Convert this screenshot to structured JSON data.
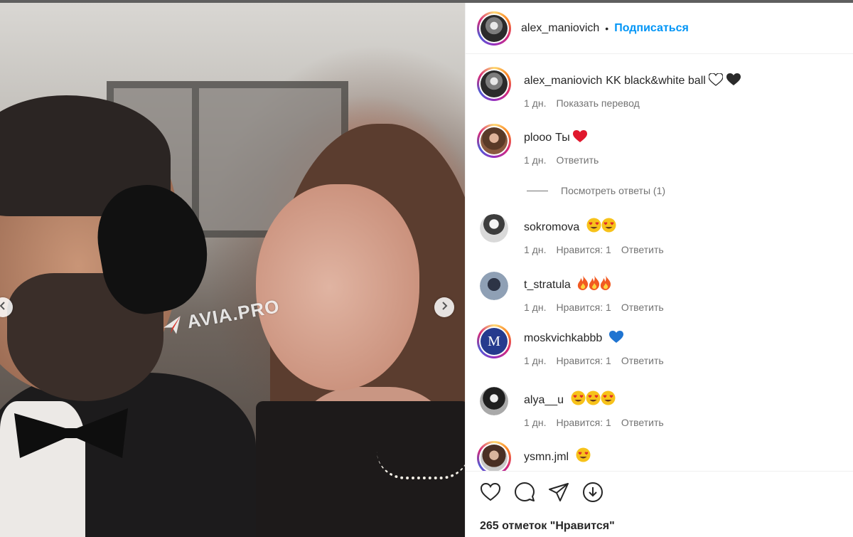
{
  "post": {
    "owner": "alex_maniovich",
    "follow_label": "Подписаться",
    "header_separator": "•",
    "watermark": "AVIA.PRO",
    "caption": {
      "user": "alex_maniovich",
      "text": "KK black&white ball",
      "time": "1 дн.",
      "translate_label": "Показать перевод"
    },
    "comments": [
      {
        "user": "plooo",
        "text": "Ты",
        "emoji": [
          "red-heart"
        ],
        "time": "1 дн.",
        "likes": "",
        "reply": "Ответить"
      },
      {
        "user": "sokromova",
        "text": "",
        "emoji": [
          "heart-eyes",
          "heart-eyes"
        ],
        "time": "1 дн.",
        "likes": "Нравится: 1",
        "reply": "Ответить"
      },
      {
        "user": "t_stratula",
        "text": "",
        "emoji": [
          "fire",
          "fire",
          "fire"
        ],
        "time": "1 дн.",
        "likes": "Нравится: 1",
        "reply": "Ответить"
      },
      {
        "user": "moskvichkabbb",
        "text": "",
        "emoji": [
          "blue-heart"
        ],
        "time": "1 дн.",
        "likes": "Нравится: 1",
        "reply": "Ответить"
      },
      {
        "user": "alya__u",
        "text": "",
        "emoji": [
          "heart-eyes",
          "heart-eyes",
          "heart-eyes"
        ],
        "time": "1 дн.",
        "likes": "Нравится: 1",
        "reply": "Ответить"
      },
      {
        "user": "ysmn.jml",
        "text": "",
        "emoji": [
          "heart-eyes"
        ],
        "time": "",
        "likes": "",
        "reply": ""
      }
    ],
    "view_replies_label": "Посмотреть ответы (1)",
    "moskvichkabbb_avatar_letter": "M",
    "likes_text": "265 отметок \"Нравится\""
  },
  "colors": {
    "link_blue": "#0095f6",
    "text": "#262626",
    "secondary_text": "#737373",
    "divider": "#efefef"
  }
}
